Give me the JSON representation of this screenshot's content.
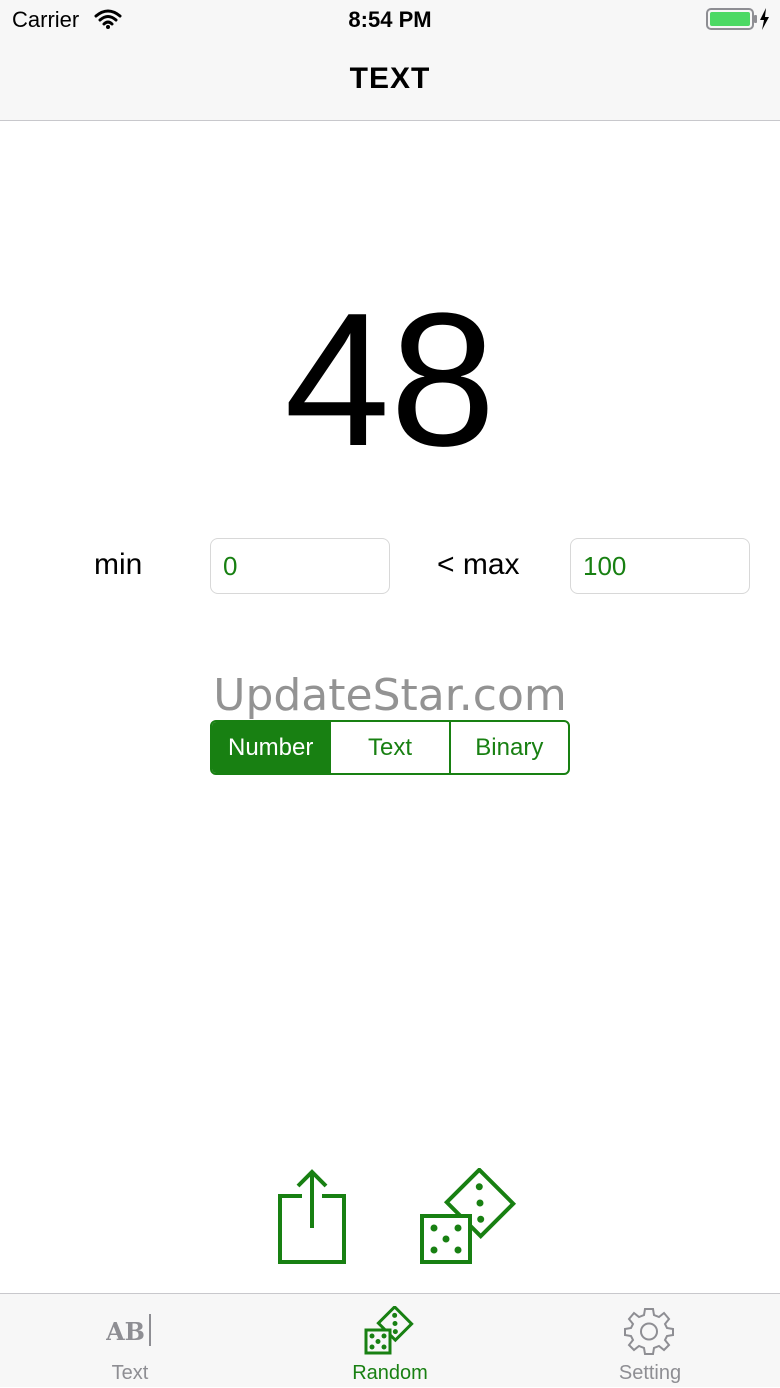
{
  "status_bar": {
    "carrier": "Carrier",
    "time": "8:54 PM"
  },
  "nav": {
    "title": "TEXT"
  },
  "result": {
    "value": "48"
  },
  "range": {
    "min_label": "min",
    "min_value": "0",
    "max_label": "< max",
    "max_value": "100"
  },
  "watermark": "UpdateStar.com",
  "mode_selector": {
    "options": [
      "Number",
      "Text",
      "Binary"
    ],
    "selected": "Number"
  },
  "actions": {
    "share_icon": "share-icon",
    "roll_icon": "dice-icon"
  },
  "tabs": [
    {
      "label": "Text",
      "icon": "ab-text-icon"
    },
    {
      "label": "Random",
      "icon": "dice-icon"
    },
    {
      "label": "Setting",
      "icon": "gear-icon"
    }
  ],
  "selected_tab": "Random",
  "colors": {
    "accent": "#188012",
    "inactive": "#8e8e93",
    "bar_bg": "#f7f7f7"
  }
}
